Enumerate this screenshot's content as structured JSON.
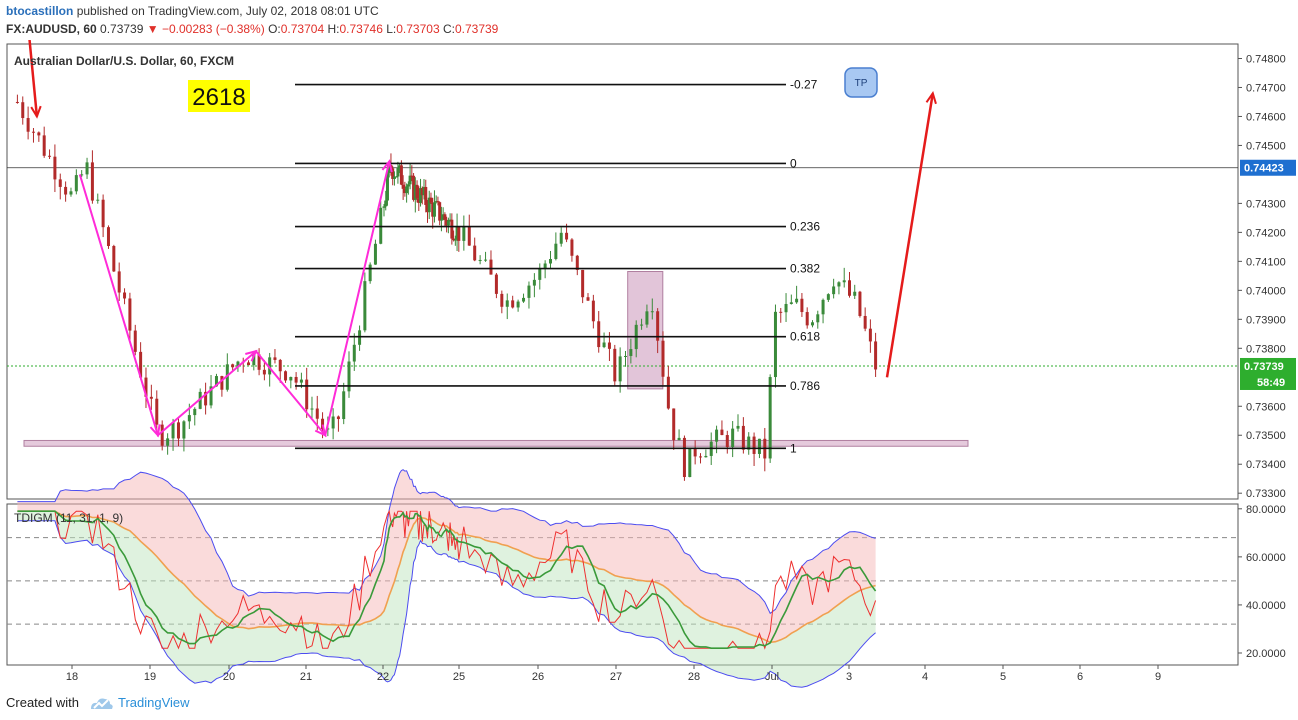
{
  "header": {
    "author": "btocastillon",
    "published": "published on TradingView.com, July 02, 2018 08:01 UTC",
    "symbol": "FX:AUDUSD, 60",
    "last": "0.73739",
    "change": "▼ −0.00283 (−0.38%)",
    "o_label": "O:",
    "o": "0.73704",
    "h_label": "H:",
    "h": "0.73746",
    "l_label": "L:",
    "l": "0.73703",
    "c_label": "C:",
    "c": "0.73739"
  },
  "footer": {
    "created": "Created with",
    "brand": "TradingView"
  },
  "colors": {
    "up": "#3a8a3a",
    "down": "#b22a2a",
    "magenta": "#ff2bd8",
    "arrow": "#e51b1b",
    "zone": "#cf9fc0",
    "label_bg": "#1e6fd0",
    "price_bg": "#2eae2e",
    "tp_fill": "#a8c8f2",
    "tp_stroke": "#4a7fd0",
    "highlight": "#ffff00"
  },
  "chart_data": [
    {
      "type": "candlestick",
      "title": "Australian Dollar/U.S. Dollar, 60, FXCM",
      "ylim": [
        0.7328,
        0.7485
      ],
      "y_ticks": [
        "0.74800",
        "0.74700",
        "0.74600",
        "0.74500",
        "0.74300",
        "0.74200",
        "0.74100",
        "0.74000",
        "0.73900",
        "0.73800",
        "0.73600",
        "0.73500",
        "0.73400",
        "0.73300"
      ],
      "x_ticks": [
        "18",
        "19",
        "20",
        "21",
        "22",
        "25",
        "26",
        "27",
        "28",
        "Jul",
        "3",
        "4",
        "5",
        "6",
        "9"
      ],
      "price_line": {
        "value": 0.73739,
        "label": "0.73739",
        "countdown": "58:49"
      },
      "ref_line": {
        "value": 0.74423,
        "label": "0.74423"
      },
      "annotation_number": "2618",
      "tp_label": "TP",
      "fib_levels": [
        {
          "label": "-0.27",
          "value": 0.7471
        },
        {
          "label": "0",
          "value": 0.74438
        },
        {
          "label": "0.236",
          "value": 0.7422
        },
        {
          "label": "0.382",
          "value": 0.74075
        },
        {
          "label": "0.618",
          "value": 0.7384
        },
        {
          "label": "0.786",
          "value": 0.7367
        },
        {
          "label": "1",
          "value": 0.73455
        }
      ],
      "support_zone": [
        0.73462,
        0.73482
      ],
      "resistance_box": {
        "x_from": 27.15,
        "x_to": 27.6,
        "y_from": 0.7366,
        "y_to": 0.74065
      },
      "path": [
        {
          "x": 17.3,
          "y": 0.7465
        },
        {
          "x": 18.0,
          "y": 0.7432
        },
        {
          "x": 18.18,
          "y": 0.7443
        },
        {
          "x": 19.1,
          "y": 0.735
        },
        {
          "x": 19.35,
          "y": 0.7353
        },
        {
          "x": 20.2,
          "y": 0.7378
        },
        {
          "x": 20.8,
          "y": 0.7372
        },
        {
          "x": 21.3,
          "y": 0.7349
        },
        {
          "x": 21.42,
          "y": 0.7356
        },
        {
          "x": 22.0,
          "y": 0.7428
        },
        {
          "x": 22.3,
          "y": 0.7443
        },
        {
          "x": 22.6,
          "y": 0.744
        },
        {
          "x": 25.0,
          "y": 0.742
        },
        {
          "x": 25.6,
          "y": 0.7396
        },
        {
          "x": 26.0,
          "y": 0.7405
        },
        {
          "x": 26.3,
          "y": 0.742
        },
        {
          "x": 26.7,
          "y": 0.739
        },
        {
          "x": 27.0,
          "y": 0.737
        },
        {
          "x": 27.45,
          "y": 0.74
        },
        {
          "x": 27.7,
          "y": 0.7355
        },
        {
          "x": 27.9,
          "y": 0.7338
        },
        {
          "x": 28.0,
          "y": 0.7345
        },
        {
          "x": 28.5,
          "y": 0.735
        },
        {
          "x": 28.95,
          "y": 0.7343
        },
        {
          "x": 29.0,
          "y": 0.739
        },
        {
          "x": 29.3,
          "y": 0.7395
        },
        {
          "x": 29.5,
          "y": 0.739
        },
        {
          "x": 29.8,
          "y": 0.7405
        },
        {
          "x": 30.1,
          "y": 0.7395
        },
        {
          "x": 30.35,
          "y": 0.7374
        }
      ],
      "magenta_path": [
        {
          "x": 18.1,
          "y": 0.744
        },
        {
          "x": 19.1,
          "y": 0.735
        },
        {
          "x": 20.35,
          "y": 0.7379
        },
        {
          "x": 21.25,
          "y": 0.735
        },
        {
          "x": 22.25,
          "y": 0.74445
        }
      ],
      "forecast_arrow": {
        "from": {
          "x": 30.5,
          "y": 0.737
        },
        "to": {
          "x": 31.1,
          "y": 0.7468
        }
      },
      "top_arrow": {
        "from": {
          "x": 17.45,
          "y": 0.7488
        },
        "to": {
          "x": 17.55,
          "y": 0.746
        }
      }
    },
    {
      "type": "line",
      "title": "TDIGM (11, 31, 1, 9)",
      "ylim": [
        15,
        82
      ],
      "y_ticks": [
        "80.0000",
        "60.0000",
        "40.0000",
        "20.0000"
      ],
      "levels": [
        68,
        50,
        32
      ]
    }
  ]
}
